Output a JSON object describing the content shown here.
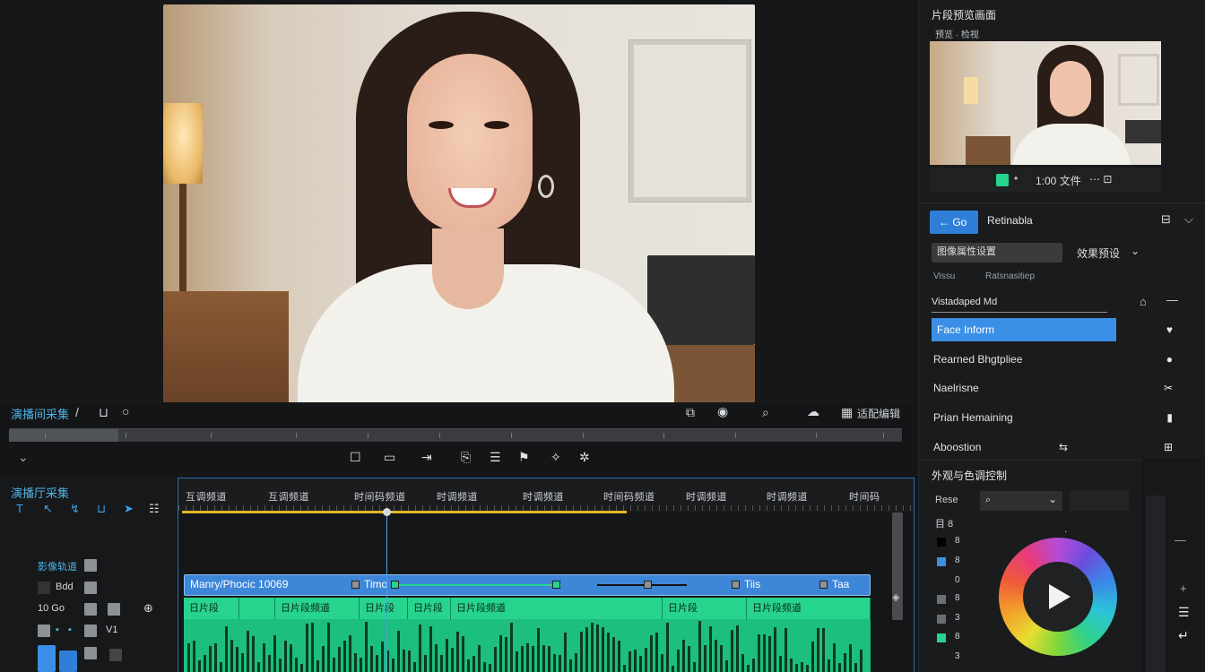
{
  "viewer": {
    "clip_title": "演播间采集",
    "toolbar_right": [
      "适配",
      "编辑"
    ]
  },
  "transport": {
    "buttons": [
      "mark-in",
      "mark-out",
      "step",
      "loop",
      "menu",
      "flag",
      "snap",
      "settings"
    ]
  },
  "source_panel": {
    "title": "片段预览画面",
    "subtitle": "预览 · 检视",
    "bar_text": "1:00 文件"
  },
  "inspector": {
    "back_label": "Go",
    "title": "Retinabla",
    "dropdown_value": "图像属性设置",
    "dropdown_right": "效果预设",
    "sub_left": "Vissu",
    "sub_right": "Ratsnasitiep",
    "search_value": "Vistadaped Md",
    "rows": [
      {
        "label": "Face Inform",
        "selected": true
      },
      {
        "label": "Rearned Bhgtpliee",
        "selected": false
      },
      {
        "label": "Naelrisne",
        "selected": false
      },
      {
        "label": "Prian Hemaining",
        "selected": false
      },
      {
        "label": "Aboostion",
        "selected": false
      }
    ]
  },
  "color_panel": {
    "title": "外观与色调控制",
    "field_label": "Rese",
    "row_labels": [
      "目 8",
      "8",
      "8",
      "0",
      "8",
      "3",
      "8",
      "3"
    ]
  },
  "timeline": {
    "sequence_title": "演播厅采集",
    "ruler_labels": [
      "互调频道",
      "互调频道",
      "时间码频道",
      "时调频道",
      "时调频道",
      "时间码频道",
      "时调频道",
      "时调频道",
      "时间码"
    ],
    "track_labels": [
      "影像轨道",
      "Bdd",
      "10 Go",
      "V1"
    ],
    "video_clip_label": "Manry/Phocic 10069",
    "video_clip_mid": "Timo",
    "video_clip_right1": "Tiis",
    "video_clip_right2": "Taa",
    "audio_headers": [
      "日片段",
      "日片段频道",
      "日片段",
      "日片段",
      "日片段频道",
      "日片段",
      "日片段频道"
    ]
  },
  "colors": {
    "accent_blue": "#3b8fe6",
    "clip_video": "#3d86d8",
    "clip_audio": "#1cbf7e",
    "work_area": "#e1b628"
  }
}
